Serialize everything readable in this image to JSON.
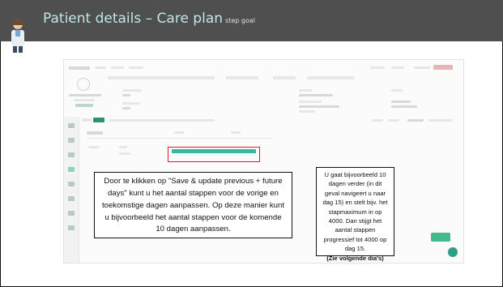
{
  "header": {
    "title": "Patient details – Care plan",
    "subtitle": "step goal"
  },
  "callouts": {
    "left_text": "Door te klikken op \"Save & update previous + future days\" kunt u het aantal stappen voor de vorige en toekomstige dagen aanpassen. Op deze manier kunt u bijvoorbeeld het aantal stappen voor de komende 10 dagen aanpassen.",
    "right_text": "U gaat bijvoorbeeld 10 dagen verder (in dit geval navigeert u naar dag 15) en stelt bijv. het stapmaximum in op 4000. Dan stijgt het aantal stappen progressief tot 4000 op dag 15.",
    "right_footer": "(Zie volgende dia's)"
  },
  "colors": {
    "header_bg": "#4f4f4f",
    "title": "#bfe7e6",
    "highlight_border": "#e21b1b",
    "accent_teal": "#37b7a5",
    "accent_green": "#45b98e"
  }
}
